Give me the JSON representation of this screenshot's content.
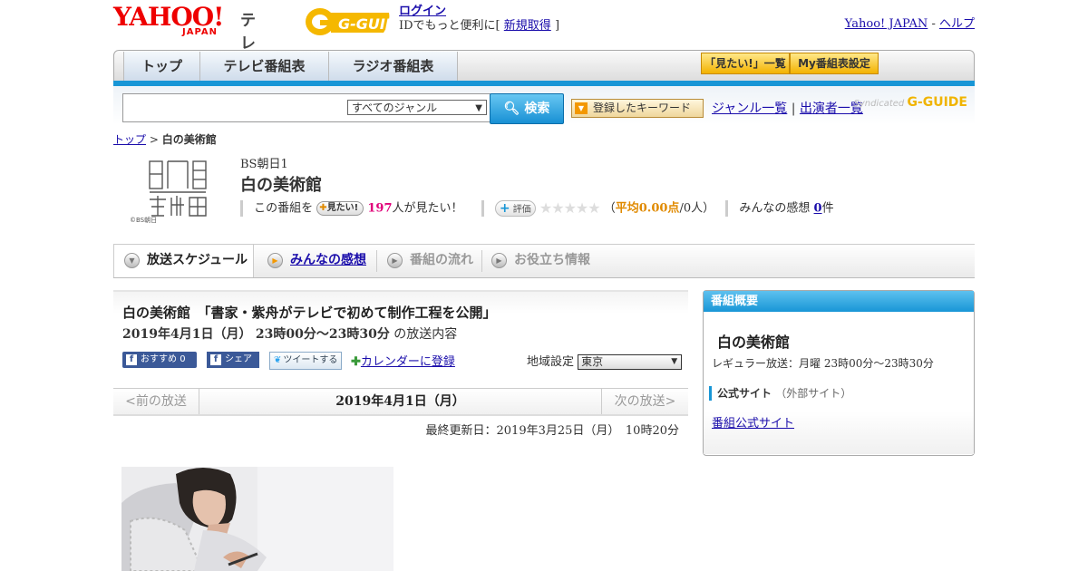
{
  "header": {
    "logo_text": "YAHOO!",
    "logo_sub": "JAPAN",
    "tv_label": "テレビ",
    "gguide_label": "G-GUIDE",
    "login_link": "ログイン",
    "login_text": "IDでもっと便利に[",
    "register_link": "新規取得",
    "login_close": "]",
    "yahoo_japan_link": "Yahoo! JAPAN",
    "link_sep": "-",
    "help_link": "ヘルプ"
  },
  "nav": {
    "tabs": [
      {
        "label": "トップ"
      },
      {
        "label": "テレビ番組表"
      },
      {
        "label": "ラジオ番組表"
      }
    ],
    "watchlist_button": "「見たい!」一覧",
    "my_guide_button": "My番組表設定"
  },
  "search": {
    "input_value": "",
    "genre_selected": "すべてのジャンル",
    "search_button": "検索",
    "keyword_button": "登録したキーワード",
    "genre_list_link": "ジャンル一覧",
    "sep": "|",
    "performer_list_link": "出演者一覧",
    "syndicated": "Syndicated",
    "syndicated_brand": "G-GUIDE"
  },
  "breadcrumb": {
    "top": "トップ",
    "sep": ">",
    "current": "白の美術館"
  },
  "program": {
    "logo_credit": "©BS朝日",
    "channel": "BS朝日1",
    "title": "白の美術館",
    "this_program": "この番組を",
    "mitai_button": "見たい!",
    "watch_count": "197",
    "watch_suffix": "人が見たい！",
    "rate_button": "評価",
    "stars": "★★★★★",
    "rating_open": "（",
    "rating_avg": "平均0.00点",
    "rating_count": "/0人）",
    "impressions_label": "みんなの感想",
    "impressions_count": "0",
    "impressions_suffix": "件"
  },
  "tabs": [
    {
      "label": "放送スケジュール"
    },
    {
      "label": "みんなの感想"
    },
    {
      "label": "番組の流れ"
    },
    {
      "label": "お役立ち情報"
    }
  ],
  "main": {
    "episode_title": "白の美術館　「書家・紫舟がテレビで初めて制作工程を公開」",
    "air_date": "2019年4月1日（月）",
    "air_time": "23時00分～23時30分",
    "air_suffix": "の放送内容",
    "recommend_button": "おすすめ",
    "recommend_count": "0",
    "share_button": "シェア",
    "tweet_button": "ツイートする",
    "calendar_link": "カレンダーに登録",
    "region_label": "地域設定",
    "region_value": "東京",
    "prev_label": "<前の放送",
    "current_date": "2019年4月1日（月）",
    "next_label": "次の放送>",
    "last_updated": "最終更新日：2019年3月25日（月）　10時20分"
  },
  "sidebar": {
    "header": "番組概要",
    "title": "白の美術館",
    "regular": "レギュラー放送：月曜 23時00分～23時30分",
    "official_label": "公式サイト",
    "official_note": "（外部サイト）",
    "official_link": "番組公式サイト"
  },
  "colors": {
    "accent_blue": "#1896d6",
    "yahoo_red": "#e00000",
    "pink": "#e0007a",
    "orange": "#e08a00"
  }
}
